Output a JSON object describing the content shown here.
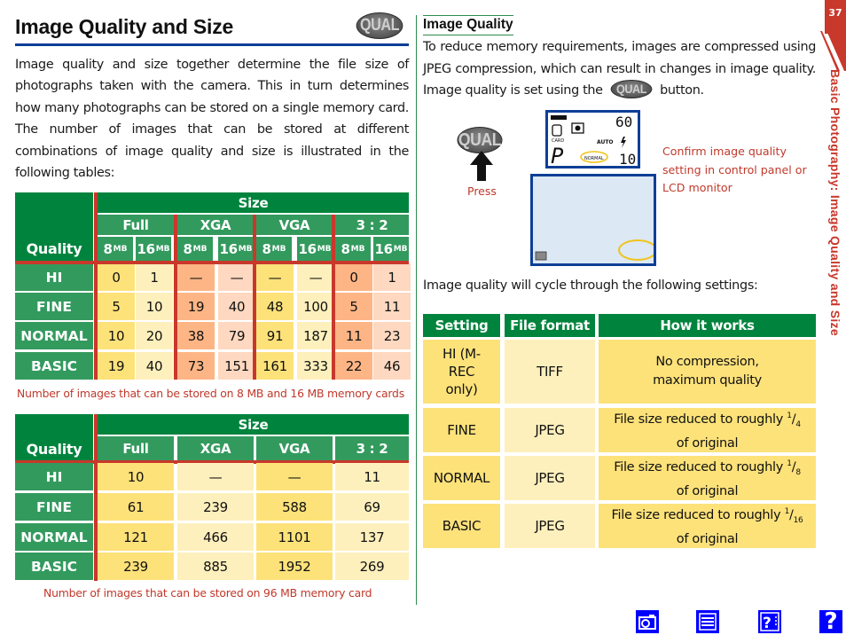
{
  "page": {
    "title": "Image Quality and Size",
    "page_number": "37",
    "side_label": "Basic Photography: Image Quality and Size",
    "qual_button_label": "QUAL"
  },
  "intro": "Image quality and size together determine the file size of photographs taken with the camera. This in turn determines how many photographs can be stored on a single memory card. The number of images that can be stored at different combinations of image quality and size is illustrated in the following tables:",
  "table1": {
    "size_header": "Size",
    "quality_header": "Quality",
    "size_groups": [
      "Full",
      "XGA",
      "VGA",
      "3 : 2"
    ],
    "card_labels": [
      {
        "num": "8",
        "unit": "MB"
      },
      {
        "num": "16",
        "unit": "MB"
      }
    ],
    "rows": [
      {
        "label": "HI",
        "values": [
          "0",
          "1",
          "—",
          "—",
          "—",
          "—",
          "0",
          "1"
        ]
      },
      {
        "label": "FINE",
        "values": [
          "5",
          "10",
          "19",
          "40",
          "48",
          "100",
          "5",
          "11"
        ]
      },
      {
        "label": "NORMAL",
        "values": [
          "10",
          "20",
          "38",
          "79",
          "91",
          "187",
          "11",
          "23"
        ]
      },
      {
        "label": "BASIC",
        "values": [
          "19",
          "40",
          "73",
          "151",
          "161",
          "333",
          "22",
          "46"
        ]
      }
    ],
    "caption": "Number of images that can be stored on 8 MB and 16 MB memory cards"
  },
  "table2": {
    "size_header": "Size",
    "quality_header": "Quality",
    "size_groups": [
      "Full",
      "XGA",
      "VGA",
      "3 : 2"
    ],
    "rows": [
      {
        "label": "HI",
        "values": [
          "10",
          "—",
          "—",
          "11"
        ]
      },
      {
        "label": "FINE",
        "values": [
          "61",
          "239",
          "588",
          "69"
        ]
      },
      {
        "label": "NORMAL",
        "values": [
          "121",
          "466",
          "1101",
          "137"
        ]
      },
      {
        "label": "BASIC",
        "values": [
          "239",
          "885",
          "1952",
          "269"
        ]
      }
    ],
    "caption": "Number of images that can be stored on 96 MB memory card"
  },
  "image_quality": {
    "heading": "Image Quality",
    "para_before": "To reduce memory requirements, images are compressed using JPEG compression, which can result in changes in image quality.  Image quality is set using the",
    "para_after": "button.",
    "press_label": "Press",
    "confirm_text": "Confirm image quality setting in control panel or LCD monitor",
    "control_panel": {
      "shutter": "60",
      "mode": "P",
      "auto": "AUTO",
      "quality": "NORMAL",
      "card": "CARD",
      "frames": "10"
    },
    "cycle_text": "Image quality will cycle through the following settings:"
  },
  "settings_table": {
    "headers": [
      "Setting",
      "File format",
      "How it works"
    ],
    "rows": [
      {
        "setting": "HI (M-REC only)",
        "format": "TIFF",
        "how": "No compression, maximum quality",
        "fraction": ""
      },
      {
        "setting": "FINE",
        "format": "JPEG",
        "how": "File size reduced to roughly",
        "fraction": "4",
        "suffix": "of original"
      },
      {
        "setting": "NORMAL",
        "format": "JPEG",
        "how": "File size reduced to roughly",
        "fraction": "8",
        "suffix": "of original"
      },
      {
        "setting": "BASIC",
        "format": "JPEG",
        "how": "File size reduced to roughly",
        "fraction": "16",
        "suffix": "of original"
      }
    ]
  },
  "nav_icons": [
    "camera-icon",
    "contents-icon",
    "index-help-icon",
    "help-icon"
  ],
  "colors": {
    "accent_green": "#00843d",
    "mid_green": "#339a5e",
    "divider_red": "#c8382b",
    "title_rule_blue": "#0e3f96",
    "caption_red": "#c0392b",
    "cell_yellow": "#fde27a",
    "cell_pale_yellow": "#fef0bc",
    "cell_orange": "#feb585",
    "cell_pale_orange": "#fed8c0",
    "nav_blue": "#0000ff"
  }
}
